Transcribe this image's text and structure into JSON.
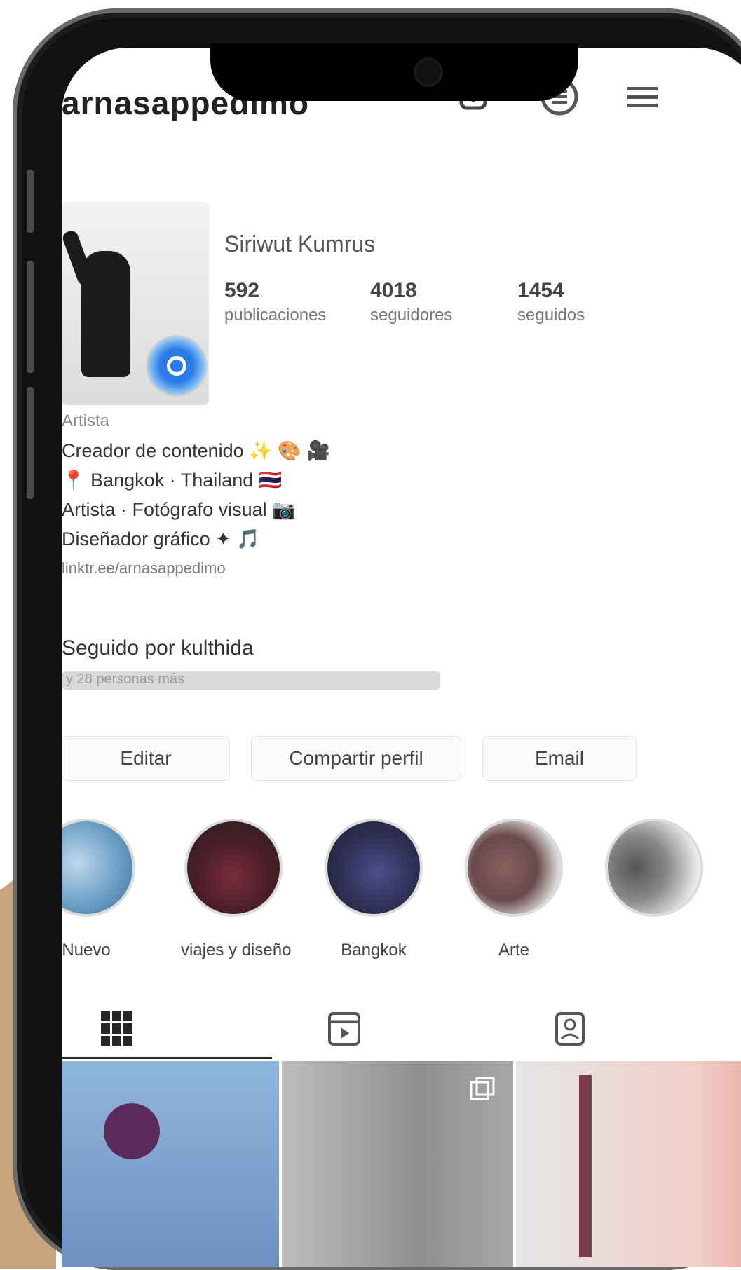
{
  "header": {
    "username": "arnasappedimo",
    "icons": [
      "add-post-icon",
      "menu-icon"
    ]
  },
  "profile": {
    "display_name": "Siriwut Kumrus",
    "stats": [
      {
        "value": "592",
        "label": "publicaciones"
      },
      {
        "value": "4018",
        "label": "seguidores"
      },
      {
        "value": "1454",
        "label": "seguidos"
      }
    ],
    "category": "Artista",
    "bio_lines": [
      "Creador de contenido ✨ 🎨 🎥",
      "📍 Bangkok · Thailand 🇹🇭",
      "Artista · Fotógrafo visual 📷",
      "Diseñador gráfico ✦ 🎵"
    ],
    "link": "linktr.ee/arnasappedimo"
  },
  "followed_by": {
    "title": "Seguido por kulthida",
    "subtitle": "y 28 personas más"
  },
  "buttons": {
    "follow": "Editar",
    "message": "Compartir perfil",
    "more": "Email"
  },
  "highlights": [
    {
      "label": "Nuevo"
    },
    {
      "label": "viajes y diseño"
    },
    {
      "label": "Bangkok"
    },
    {
      "label": "Arte"
    }
  ],
  "tabs": [
    "grid-icon",
    "reels-icon",
    "tagged-icon"
  ],
  "colors": {
    "accent": "#2a7be8",
    "text": "#262626",
    "background_shape": "#c9a37e"
  }
}
